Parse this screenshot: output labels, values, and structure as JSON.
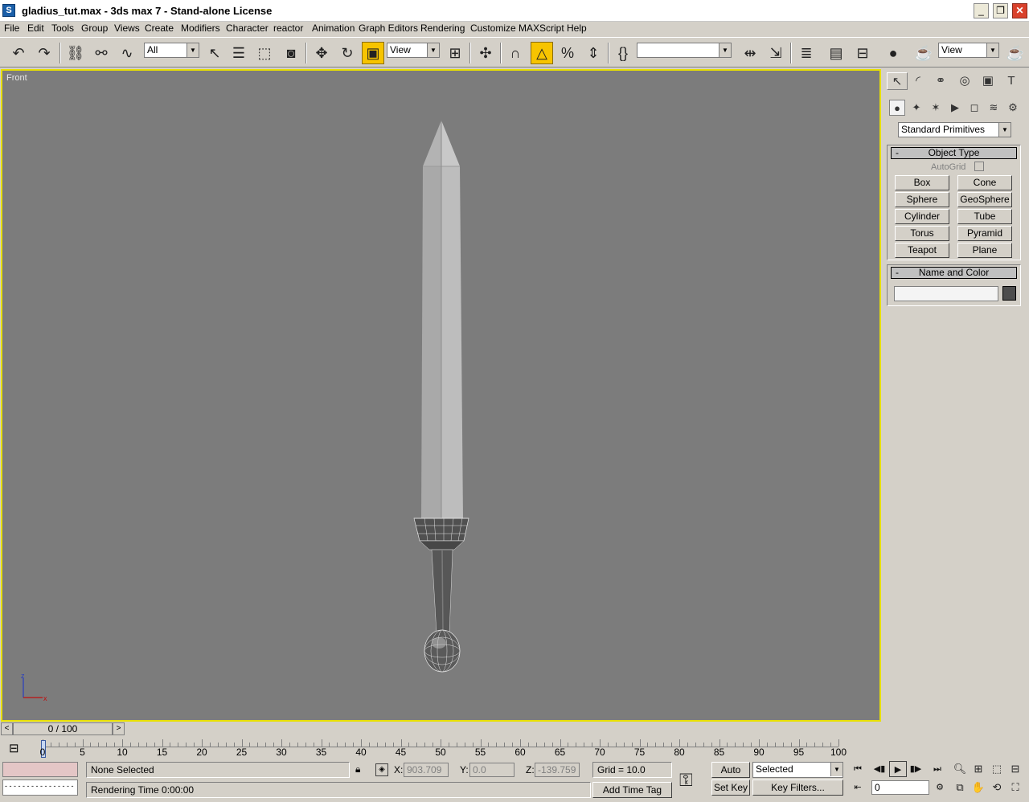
{
  "window": {
    "title": "gladius_tut.max - 3ds max 7  - Stand-alone License",
    "app_icon_letter": "S"
  },
  "menu": [
    "File",
    "Edit",
    "Tools",
    "Group",
    "Views",
    "Create",
    "Modifiers",
    "Character",
    "reactor",
    "Animation",
    "Graph Editors",
    "Rendering",
    "Customize",
    "MAXScript",
    "Help"
  ],
  "toolbar": {
    "selection_filter": "All",
    "ref_coord": "View",
    "named_selection": "",
    "render_view": "View"
  },
  "viewport": {
    "label": "Front",
    "axis_z": "z",
    "axis_x": "x",
    "bg_color": "#7c7c7c",
    "border_color": "#e8e000"
  },
  "command_panel": {
    "primitive_dropdown": "Standard Primitives",
    "object_type_title": "Object Type",
    "autogrid_label": "AutoGrid",
    "buttons": [
      "Box",
      "Cone",
      "Sphere",
      "GeoSphere",
      "Cylinder",
      "Tube",
      "Torus",
      "Pyramid",
      "Teapot",
      "Plane"
    ],
    "name_color_title": "Name and Color",
    "swatch_color": "#4d4d4d"
  },
  "timeline": {
    "slider": "0 / 100",
    "ticks": [
      "0",
      "5",
      "10",
      "15",
      "20",
      "25",
      "30",
      "35",
      "40",
      "45",
      "50",
      "55",
      "60",
      "65",
      "70",
      "75",
      "80",
      "85",
      "90",
      "95",
      "100"
    ],
    "current_frame": 0
  },
  "status": {
    "selection": "None Selected",
    "prompt": "Rendering Time  0:00:00",
    "x_label": "X:",
    "x_value": "903.709",
    "y_label": "Y:",
    "y_value": "0.0",
    "z_label": "Z:",
    "z_value": "-139.759",
    "grid": "Grid = 10.0",
    "add_time_tag": "Add Time Tag",
    "auto_key": "Auto Key",
    "set_key": "Set Key",
    "key_mode": "Selected",
    "key_filters": "Key Filters...",
    "frame": "0"
  }
}
